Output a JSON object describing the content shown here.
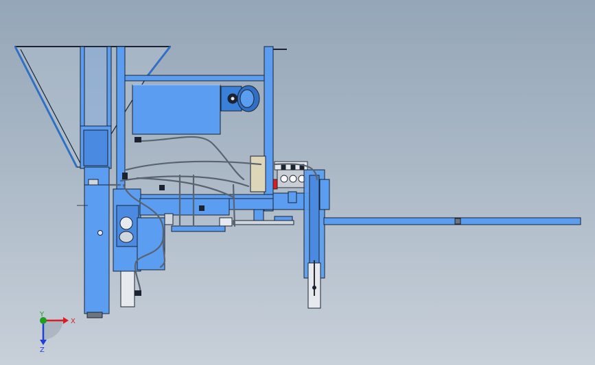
{
  "viewport": {
    "background_top": "#95a6b8",
    "background_bottom": "#c8d0d9"
  },
  "colors": {
    "body_blue": "#5b9df0",
    "body_blue_dark": "#2f6fc4",
    "edge": "#1b2330",
    "hose": "#5a6470",
    "chrome": "#e6e9ee",
    "panel_beige": "#ddd6b8"
  },
  "triad": {
    "x_label": "X",
    "y_label": "Y",
    "z_label": "Z",
    "x_color": "#d81e1e",
    "y_color": "#1ea01e",
    "z_color": "#1e3fd8"
  }
}
